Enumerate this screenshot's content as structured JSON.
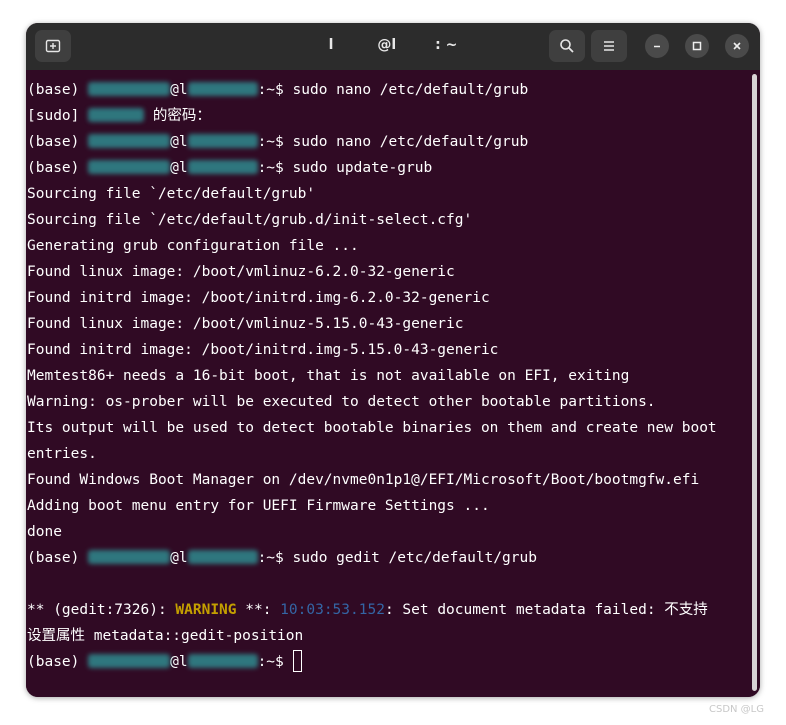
{
  "window": {
    "title": "l         @l        : ~"
  },
  "terminal": {
    "prompt_prefix": "(base) ",
    "prompt_suffix": ":~$ ",
    "lines": [
      {
        "type": "prompt",
        "command": "sudo nano /etc/default/grub"
      },
      {
        "type": "sudo",
        "prefix": "[sudo] ",
        "suffix": " 的密码："
      },
      {
        "type": "prompt",
        "command": "sudo nano /etc/default/grub"
      },
      {
        "type": "prompt",
        "command": "sudo update-grub"
      },
      {
        "type": "text",
        "text": "Sourcing file `/etc/default/grub'"
      },
      {
        "type": "text",
        "text": "Sourcing file `/etc/default/grub.d/init-select.cfg'"
      },
      {
        "type": "text",
        "text": "Generating grub configuration file ..."
      },
      {
        "type": "text",
        "text": "Found linux image: /boot/vmlinuz-6.2.0-32-generic"
      },
      {
        "type": "text",
        "text": "Found initrd image: /boot/initrd.img-6.2.0-32-generic"
      },
      {
        "type": "text",
        "text": "Found linux image: /boot/vmlinuz-5.15.0-43-generic"
      },
      {
        "type": "text",
        "text": "Found initrd image: /boot/initrd.img-5.15.0-43-generic"
      },
      {
        "type": "text",
        "text": "Memtest86+ needs a 16-bit boot, that is not available on EFI, exiting"
      },
      {
        "type": "text",
        "text": "Warning: os-prober will be executed to detect other bootable partitions."
      },
      {
        "type": "text",
        "text": "Its output will be used to detect bootable binaries on them and create new boot"
      },
      {
        "type": "text",
        "text": "entries."
      },
      {
        "type": "text",
        "text": "Found Windows Boot Manager on /dev/nvme0n1p1@/EFI/Microsoft/Boot/bootmgfw.efi"
      },
      {
        "type": "text",
        "text": "Adding boot menu entry for UEFI Firmware Settings ..."
      },
      {
        "type": "text",
        "text": "done"
      },
      {
        "type": "prompt",
        "command": "sudo gedit /etc/default/grub"
      },
      {
        "type": "text",
        "text": ""
      },
      {
        "type": "gedit",
        "pre": "** (gedit:7326): ",
        "warn": "WARNING",
        "mid": " **: ",
        "time": "10:03:53.152",
        "post": ": Set document metadata failed: 不支持"
      },
      {
        "type": "text",
        "text": "设置属性 metadata::gedit-position"
      },
      {
        "type": "prompt_cursor",
        "command": ""
      }
    ]
  },
  "colors": {
    "terminal_bg": "#300a24",
    "titlebar_bg": "#2c2c2c",
    "warning": "#c4a000",
    "timestamp": "#3465a4"
  },
  "icons": {
    "new_tab": "new-tab-icon",
    "search": "search-icon",
    "menu": "hamburger-menu-icon",
    "minimize": "minimize-icon",
    "maximize": "maximize-icon",
    "close": "close-icon"
  },
  "watermark": "CSDN @LG"
}
